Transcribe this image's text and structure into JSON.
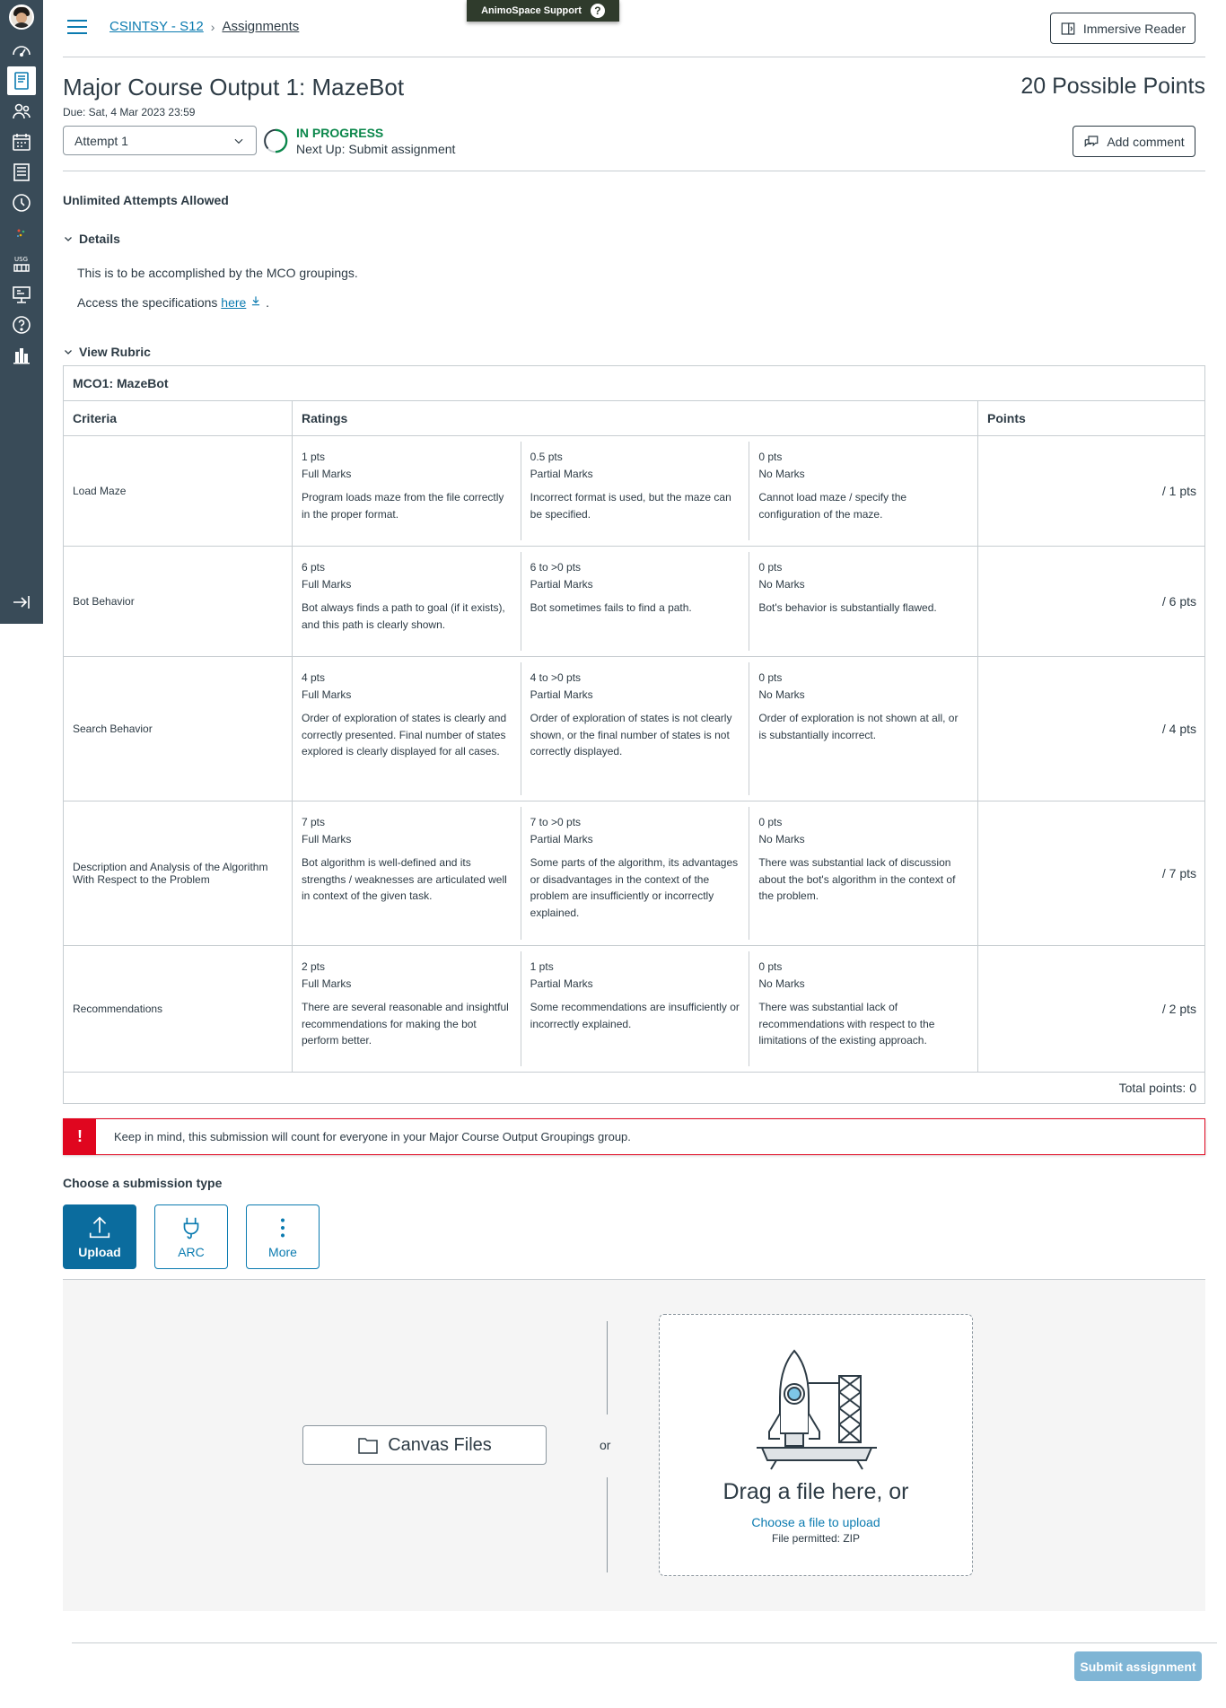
{
  "header": {
    "support_label": "AnimoSpace Support",
    "breadcrumb_course": "CSINTSY - S12",
    "breadcrumb_page": "Assignments",
    "immersive_reader_label": "Immersive Reader"
  },
  "global_nav": [
    "avatar-icon",
    "dashboard-icon",
    "courses-icon",
    "groups-icon",
    "calendar-icon",
    "inbox-icon",
    "history-icon",
    "app-icon",
    "usg-icon",
    "commons-icon",
    "help-icon",
    "library-icon",
    "collapse-icon"
  ],
  "assignment": {
    "title": "Major Course Output 1: MazeBot",
    "due": "Due: Sat, 4 Mar 2023 23:59",
    "points": "20 Possible Points",
    "attempt": "Attempt 1",
    "status": "IN PROGRESS",
    "next_up": "Next Up: Submit assignment",
    "add_comment": "Add comment",
    "unlimited": "Unlimited Attempts Allowed",
    "details_toggle": "Details",
    "desc1": "This is to be accomplished by the MCO groupings.",
    "desc2_prefix": "Access the specifications",
    "desc2_link": "here",
    "desc2_suffix": ".",
    "rubric_toggle": "View Rubric"
  },
  "rubric": {
    "title": "MCO1: MazeBot",
    "headers": {
      "criteria": "Criteria",
      "ratings": "Ratings",
      "points": "Points"
    },
    "rows": [
      {
        "criterion": "Load Maze",
        "points": "/ 1 pts",
        "ratings": [
          {
            "pts": "1 pts",
            "name": "Full Marks",
            "desc": "Program loads maze from the file correctly in the proper format."
          },
          {
            "pts": "0.5 pts",
            "name": "Partial Marks",
            "desc": "Incorrect format is used, but the maze can be specified."
          },
          {
            "pts": "0 pts",
            "name": "No Marks",
            "desc": "Cannot load maze / specify the configuration of the maze."
          }
        ]
      },
      {
        "criterion": "Bot Behavior",
        "points": "/ 6 pts",
        "ratings": [
          {
            "pts": "6 pts",
            "name": "Full Marks",
            "desc": "Bot always finds a path to goal (if it exists), and this path is clearly shown."
          },
          {
            "pts": "6 to >0 pts",
            "name": "Partial Marks",
            "desc": "Bot sometimes fails to find a path."
          },
          {
            "pts": "0 pts",
            "name": "No Marks",
            "desc": "Bot's behavior is substantially flawed."
          }
        ]
      },
      {
        "criterion": "Search Behavior",
        "points": "/ 4 pts",
        "ratings": [
          {
            "pts": "4 pts",
            "name": "Full Marks",
            "desc": "Order of exploration of states is clearly and correctly presented. Final number of states explored is clearly displayed for all cases."
          },
          {
            "pts": "4 to >0 pts",
            "name": "Partial Marks",
            "desc": "Order of exploration of states is not clearly shown, or the final number of states is not correctly displayed."
          },
          {
            "pts": "0 pts",
            "name": "No Marks",
            "desc": "Order of exploration is not shown at all, or is substantially incorrect."
          }
        ]
      },
      {
        "criterion": "Description and Analysis of the Algorithm With Respect to the Problem",
        "points": "/ 7 pts",
        "ratings": [
          {
            "pts": "7 pts",
            "name": "Full Marks",
            "desc": "Bot algorithm is well-defined and its strengths / weaknesses are articulated well in context of the given task."
          },
          {
            "pts": "7 to >0 pts",
            "name": "Partial Marks",
            "desc": "Some parts of the algorithm, its advantages or disadvantages in the context of the problem are insufficiently or incorrectly explained."
          },
          {
            "pts": "0 pts",
            "name": "No Marks",
            "desc": "There was substantial lack of discussion about the bot's algorithm in the context of the problem."
          }
        ]
      },
      {
        "criterion": "Recommendations",
        "points": "/ 2 pts",
        "ratings": [
          {
            "pts": "2 pts",
            "name": "Full Marks",
            "desc": "There are several reasonable and insightful recommendations for making the bot perform better."
          },
          {
            "pts": "1 pts",
            "name": "Partial Marks",
            "desc": "Some recommendations are insufficiently or incorrectly explained."
          },
          {
            "pts": "0 pts",
            "name": "No Marks",
            "desc": "There was substantial lack of recommendations with respect to the limitations of the existing approach."
          }
        ]
      }
    ],
    "total": "Total points: 0"
  },
  "submission": {
    "warning": "Keep in mind, this submission will count for everyone in your Major Course Output Groupings group.",
    "choose_label": "Choose a submission type",
    "types": [
      {
        "label": "Upload",
        "icon": "upload-icon",
        "selected": true
      },
      {
        "label": "ARC",
        "icon": "plug-icon",
        "selected": false
      },
      {
        "label": "More",
        "icon": "more-icon",
        "selected": false
      }
    ],
    "canvas_files": "Canvas Files",
    "or": "or",
    "drag_text": "Drag a file here, or",
    "choose_link": "Choose a file to upload",
    "permitted": "File permitted: ZIP",
    "submit": "Submit assignment"
  },
  "colors": {
    "nav_bg": "#394b58",
    "accent": "#0b7bb0",
    "success": "#0b874b",
    "danger": "#e0061f",
    "submit_disabled": "#7fb5d5"
  }
}
